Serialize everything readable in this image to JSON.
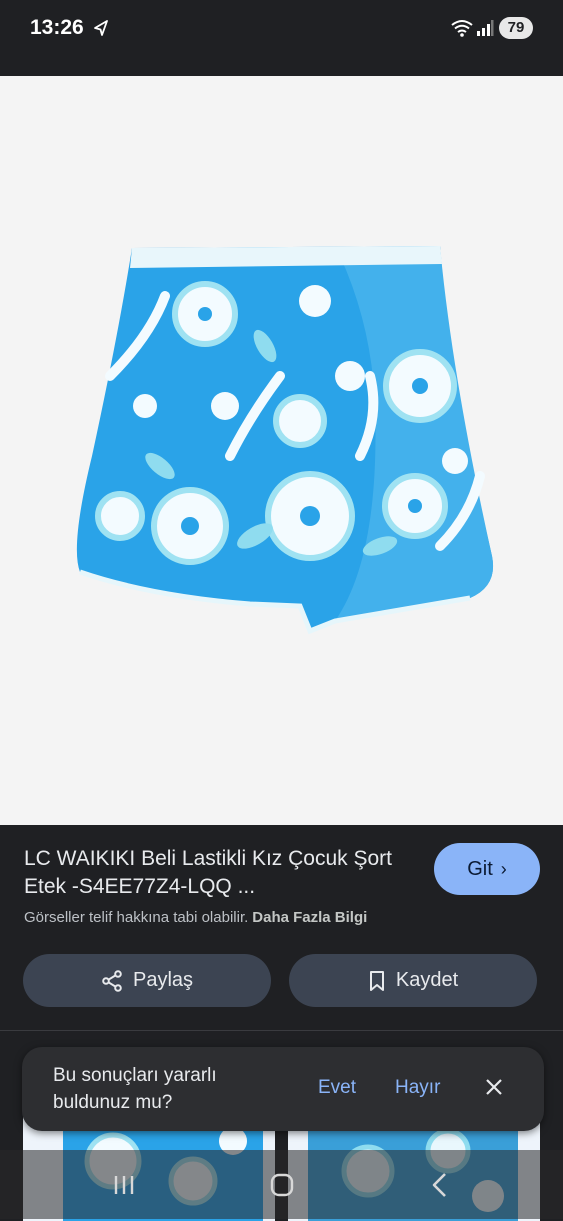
{
  "status_bar": {
    "time": "13:26",
    "battery": "79"
  },
  "product": {
    "title": "LC WAIKIKI Beli Lastikli Kız Çocuk Şort Etek -S4EE77Z4-LQQ ...",
    "go_label": "Git",
    "copyright": "Görseller telif hakkına tabi olabilir.",
    "more_info": "Daha Fazla Bilgi",
    "share_label": "Paylaş",
    "save_label": "Kaydet"
  },
  "feedback": {
    "question": "Bu sonuçları yararlı buldunuz mu?",
    "yes": "Evet",
    "no": "Hayır"
  },
  "colors": {
    "accent": "#8ab4f8",
    "fabric_blue": "#2aa3e8",
    "fabric_light": "#8fdcef",
    "panel": "#1f2023"
  },
  "icons": [
    "navigation-arrow-icon",
    "wifi-icon",
    "signal-icon",
    "google-lens-icon",
    "share-icon",
    "bookmark-icon",
    "close-icon",
    "recent-apps-icon",
    "home-icon",
    "back-icon"
  ]
}
